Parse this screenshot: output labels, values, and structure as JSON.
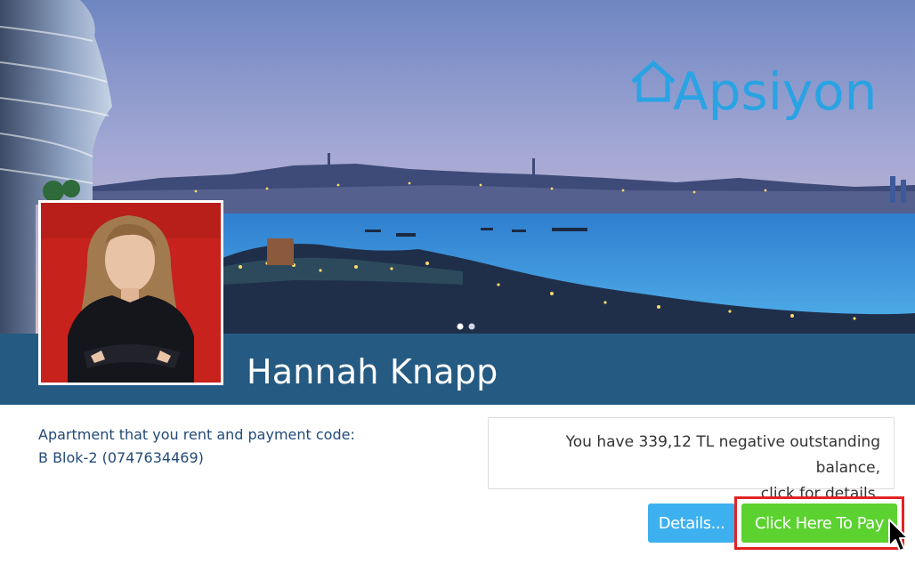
{
  "brand": {
    "name": "Apsiyon",
    "color": "#29a3e3"
  },
  "hero": {
    "slider_dots": [
      "active",
      "inactive"
    ],
    "colors": {
      "sky_top": "#7b93c8",
      "sky_bottom": "#d6b9cd",
      "sea": "#3b8ed4"
    }
  },
  "profile": {
    "name": "Hannah Knapp",
    "photo": "avatar-photo",
    "banner_color": "#255a82"
  },
  "apartment": {
    "label": "Apartment that you rent and payment code:",
    "value": "B Blok-2 (0747634469)"
  },
  "balance": {
    "line1": "You have 339,12 TL negative outstanding balance,",
    "line2": "click for details."
  },
  "actions": {
    "details_label": "Details...",
    "pay_label": "Click Here To Pay",
    "details_color": "#3db1ef",
    "pay_color": "#5bd22f",
    "highlight_color": "#e32222"
  },
  "icons": {
    "logo": "house-icon",
    "pointer": "mouse-pointer-icon"
  }
}
